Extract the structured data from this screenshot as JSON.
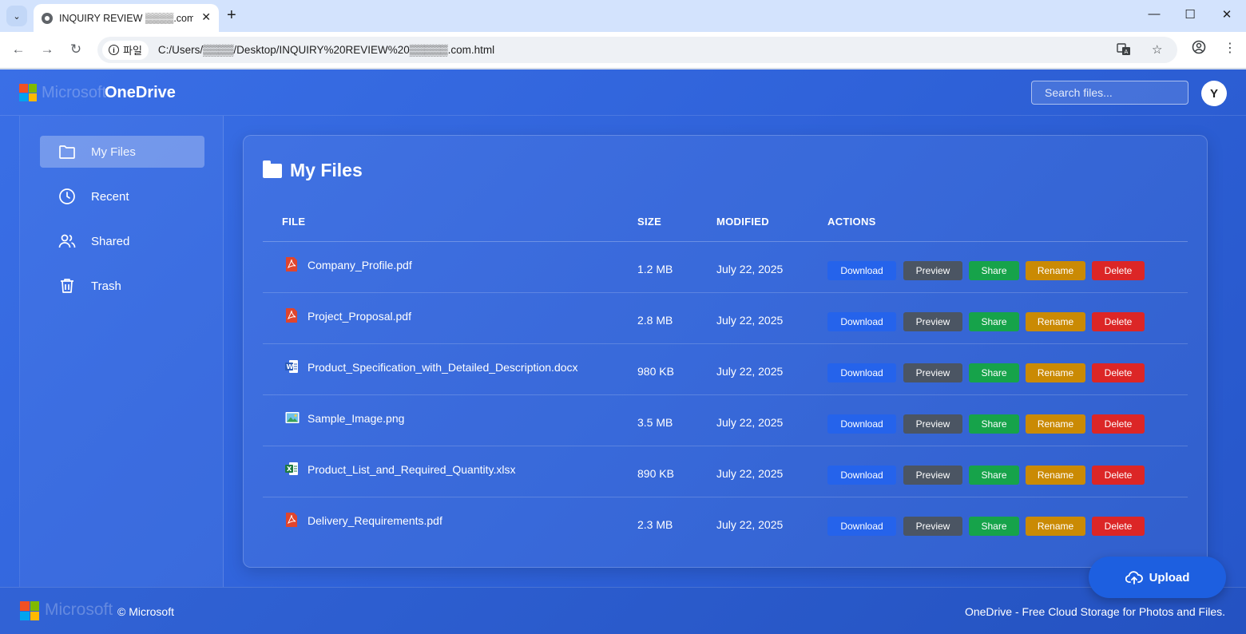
{
  "browser": {
    "tab_title": "INQUIRY REVIEW ▒▒▒▒.com.",
    "tab_close": "✕",
    "new_tab": "+",
    "site_chip": "파일",
    "url": "C:/Users/▒▒▒▒/Desktop/INQUIRY%20REVIEW%20▒▒▒▒▒.com.html",
    "controls": {
      "minimize": "—",
      "maximize": "☐",
      "close": "✕"
    },
    "nav": {
      "back": "←",
      "forward": "→",
      "reload": "↻"
    },
    "icons": {
      "translate": "translate-icon",
      "bookmark": "☆",
      "profile": "profile-icon",
      "menu": "⋮"
    }
  },
  "header": {
    "brand_ms": "Microsoft",
    "brand_product": "OneDrive",
    "search_placeholder": "Search files...",
    "avatar_letter": "Y"
  },
  "sidebar": {
    "items": [
      {
        "label": "My Files",
        "icon": "folder-icon",
        "active": true
      },
      {
        "label": "Recent",
        "icon": "clock-icon",
        "active": false
      },
      {
        "label": "Shared",
        "icon": "users-icon",
        "active": false
      },
      {
        "label": "Trash",
        "icon": "trash-icon",
        "active": false
      }
    ]
  },
  "main": {
    "title": "My Files",
    "columns": {
      "file": "FILE",
      "size": "SIZE",
      "modified": "MODIFIED",
      "actions": "ACTIONS"
    },
    "actions": {
      "download": "Download",
      "preview": "Preview",
      "share": "Share",
      "rename": "Rename",
      "delete": "Delete"
    },
    "files": [
      {
        "name": "Company_Profile.pdf",
        "type": "pdf",
        "size": "1.2 MB",
        "modified": "July 22, 2025"
      },
      {
        "name": "Project_Proposal.pdf",
        "type": "pdf",
        "size": "2.8 MB",
        "modified": "July 22, 2025"
      },
      {
        "name": "Product_Specification_with_Detailed_Description.docx",
        "type": "docx",
        "size": "980 KB",
        "modified": "July 22, 2025"
      },
      {
        "name": "Sample_Image.png",
        "type": "png",
        "size": "3.5 MB",
        "modified": "July 22, 2025"
      },
      {
        "name": "Product_List_and_Required_Quantity.xlsx",
        "type": "xlsx",
        "size": "890 KB",
        "modified": "July 22, 2025"
      },
      {
        "name": "Delivery_Requirements.pdf",
        "type": "pdf",
        "size": "2.3 MB",
        "modified": "July 22, 2025"
      }
    ],
    "upload_label": "Upload"
  },
  "footer": {
    "brand": "Microsoft",
    "copyright": "© Microsoft",
    "tagline": "OneDrive - Free Cloud Storage for Photos and Files."
  },
  "colors": {
    "ms_red": "#f25022",
    "ms_green": "#7fba00",
    "ms_blue": "#00a4ef",
    "ms_yellow": "#ffb900",
    "download": "#2563eb",
    "preview": "#4b5563",
    "share": "#16a34a",
    "rename": "#ca8a04",
    "delete": "#dc2626"
  }
}
